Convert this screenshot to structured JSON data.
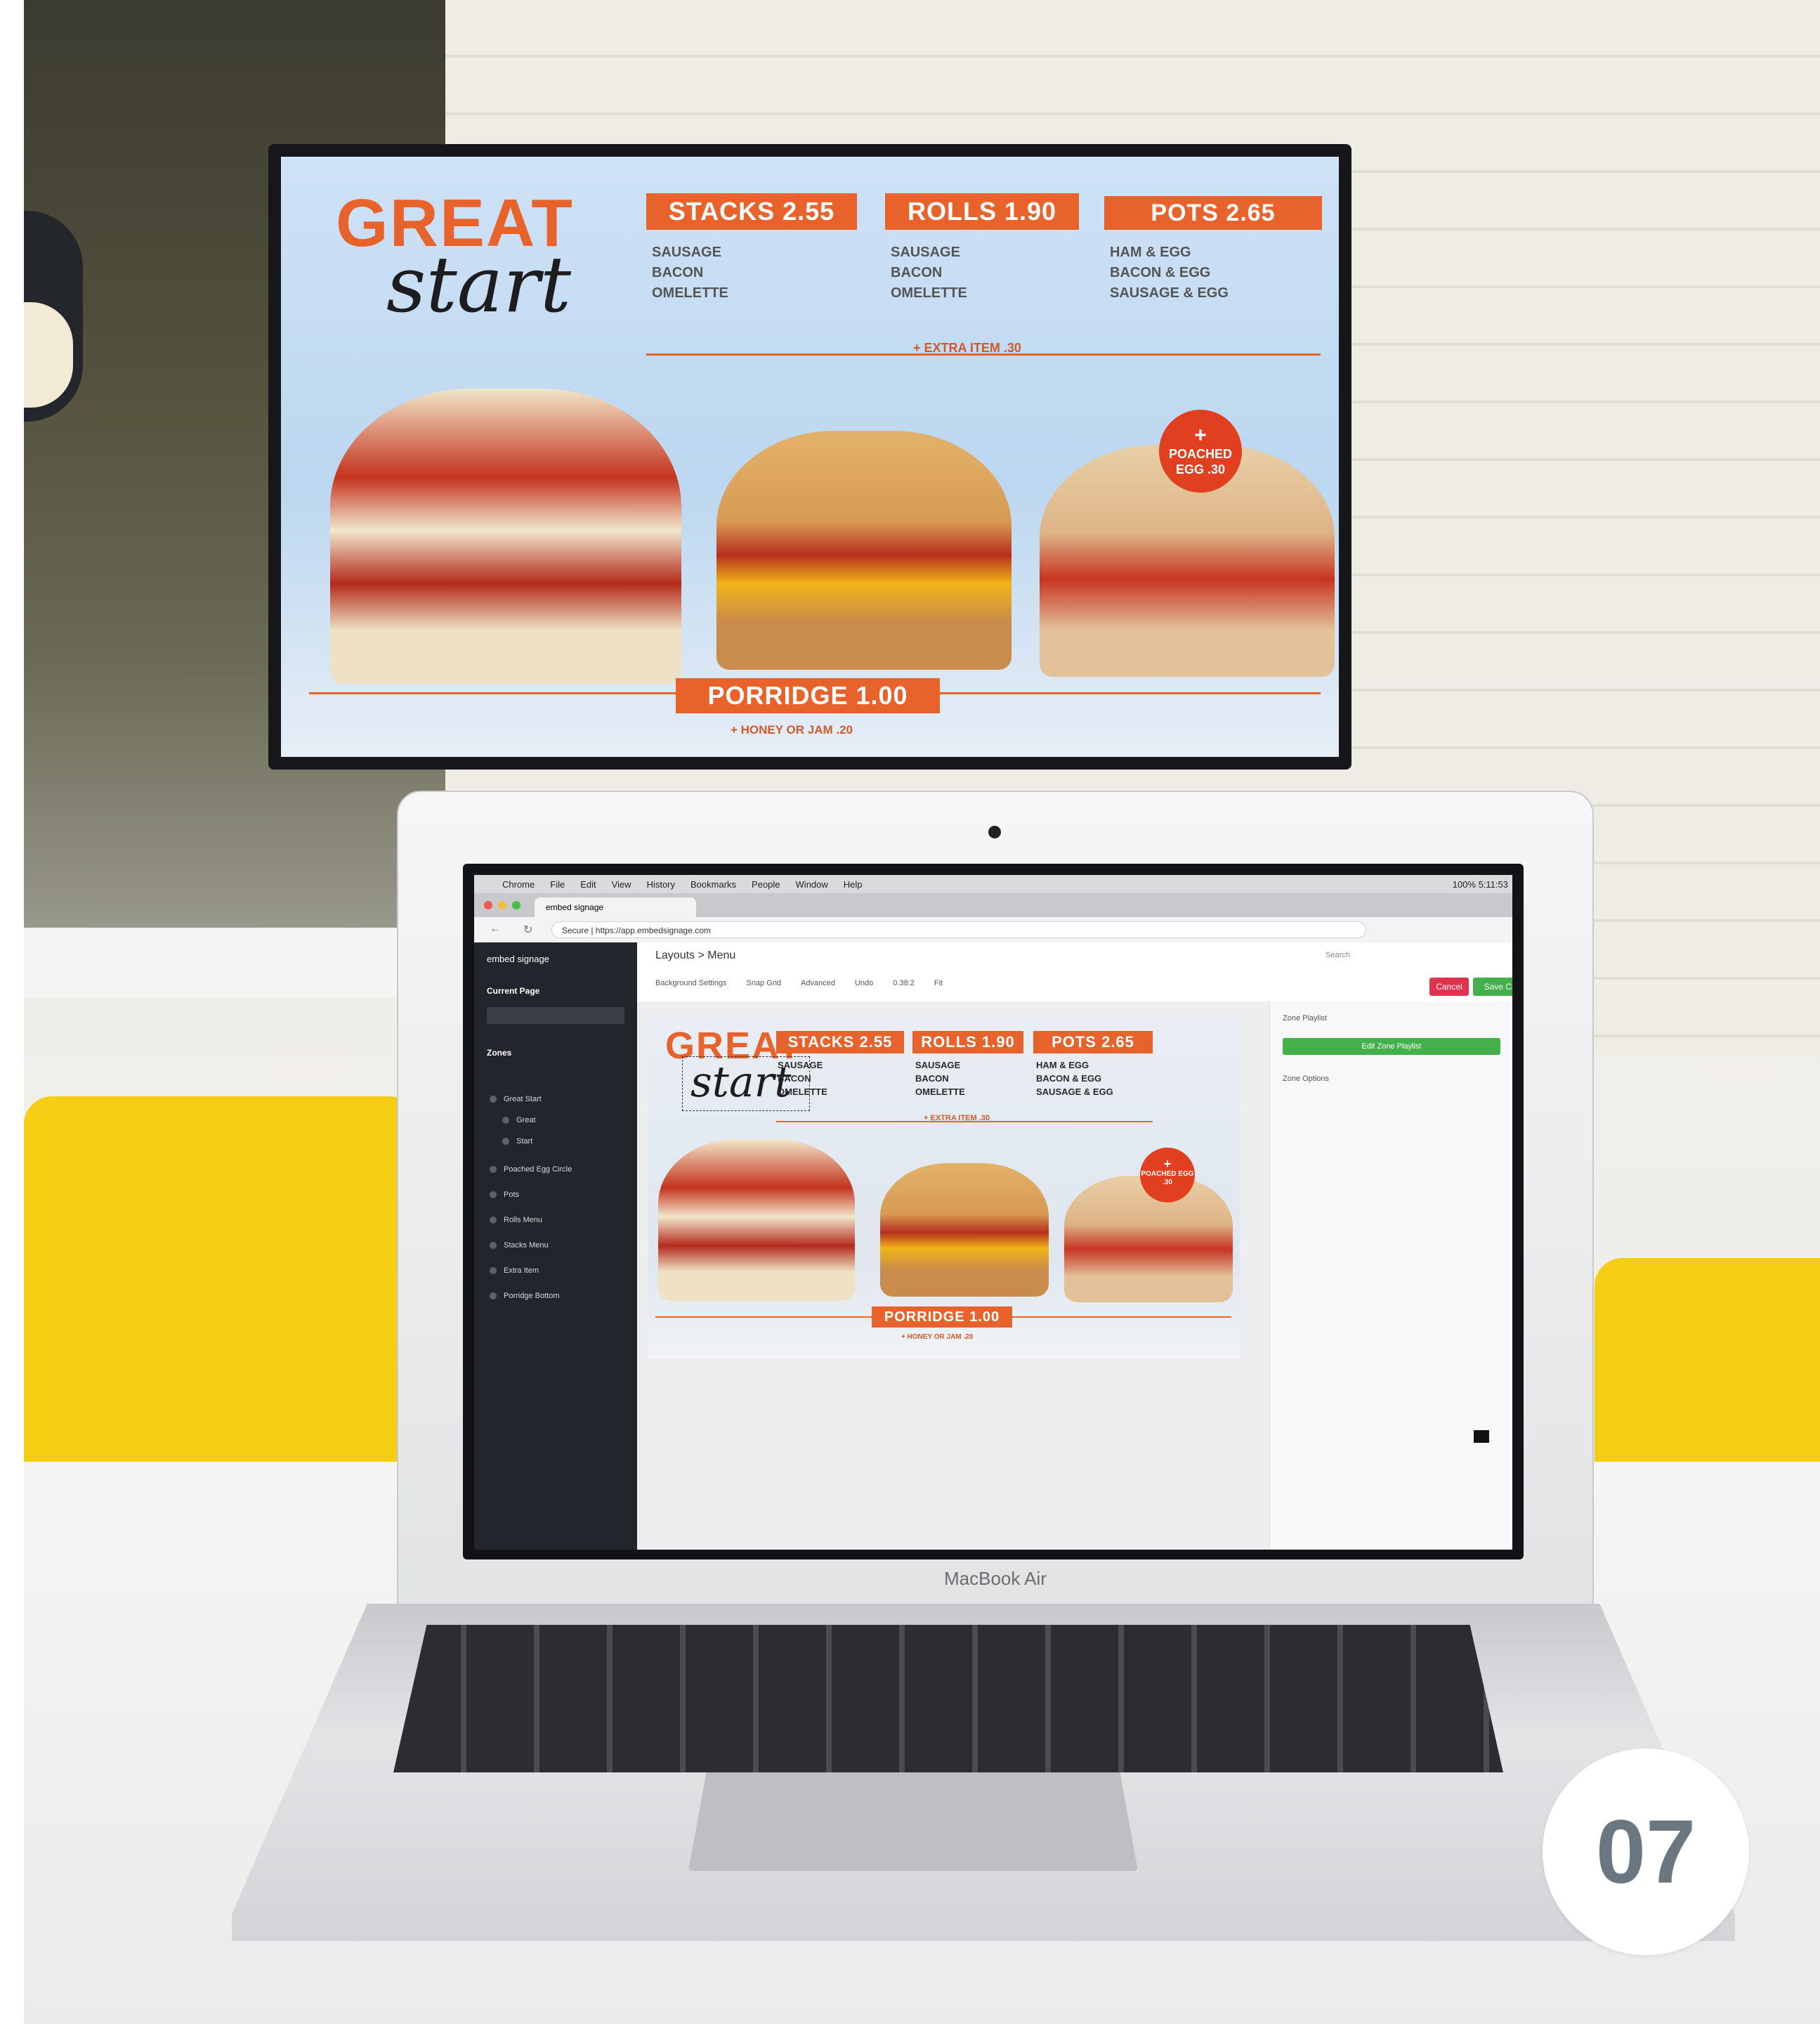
{
  "photo": {
    "corner_badge": "07"
  },
  "menu_board": {
    "title_top": "GREAT",
    "title_script": "start",
    "columns": [
      {
        "heading": "STACKS 2.55",
        "items": [
          "SAUSAGE",
          "BACON",
          "OMELETTE"
        ]
      },
      {
        "heading": "ROLLS 1.90",
        "items": [
          "SAUSAGE",
          "BACON",
          "OMELETTE"
        ]
      },
      {
        "heading": "POTS 2.65",
        "items": [
          "HAM & EGG",
          "BACON & EGG",
          "SAUSAGE & EGG"
        ]
      }
    ],
    "extra": "+ EXTRA ITEM .30",
    "badge_plus": "+",
    "badge_text": "POACHED EGG .30",
    "porridge": "PORRIDGE 1.00",
    "porridge_extra": "+ HONEY OR JAM .20",
    "colors": {
      "accent": "#e8632b",
      "badge": "#e0401f"
    }
  },
  "laptop": {
    "brand": "MacBook Air",
    "menubar": [
      "Chrome",
      "File",
      "Edit",
      "View",
      "History",
      "Bookmarks",
      "People",
      "Window",
      "Help"
    ],
    "menubar_status": "100%  5:11:53",
    "tab_title": "embed signage",
    "url": "Secure | https://app.embedsignage.com",
    "app": {
      "logo": "embed signage",
      "current_page_label": "Current Page",
      "zones_label": "Zones",
      "zones": [
        "Great Start",
        "Great",
        "Start",
        "Poached Egg Circle",
        "Pots",
        "Rolls Menu",
        "Stacks Menu",
        "Extra Item",
        "Porridge Bottom"
      ],
      "breadcrumb": "Layouts  >  Menu",
      "search_placeholder": "Search",
      "tools": [
        "Background Settings",
        "Snap Grid",
        "Advanced",
        "Undo",
        "0.38:2",
        "Fit"
      ],
      "cancel_label": "Cancel",
      "save_label": "Save Changes",
      "props": {
        "zone_playlist": "Zone Playlist",
        "edit_playlist": "Edit Zone Playlist",
        "zone_options": "Zone Options"
      }
    }
  }
}
